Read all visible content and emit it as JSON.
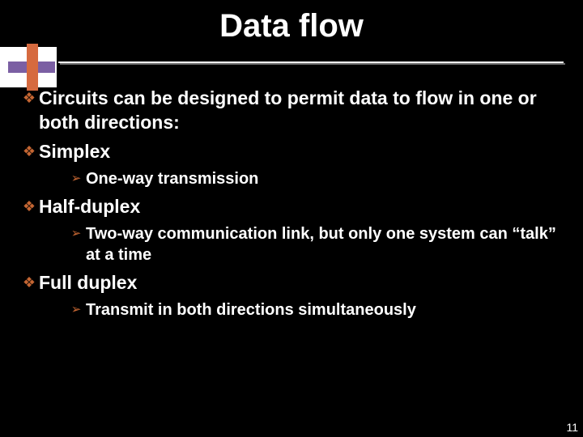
{
  "title": "Data flow",
  "bullets": {
    "b0": "Circuits can be designed to permit data to flow in one or both directions:",
    "b1": "Simplex",
    "b1_0": "One-way transmission",
    "b2": "Half-duplex",
    "b2_0": "Two-way communication link, but only one system can “talk” at a time",
    "b3": "Full duplex",
    "b3_0": "Transmit in both directions simultaneously"
  },
  "glyphs": {
    "diamond": "❖",
    "arrow": "➢"
  },
  "page_number": "11"
}
